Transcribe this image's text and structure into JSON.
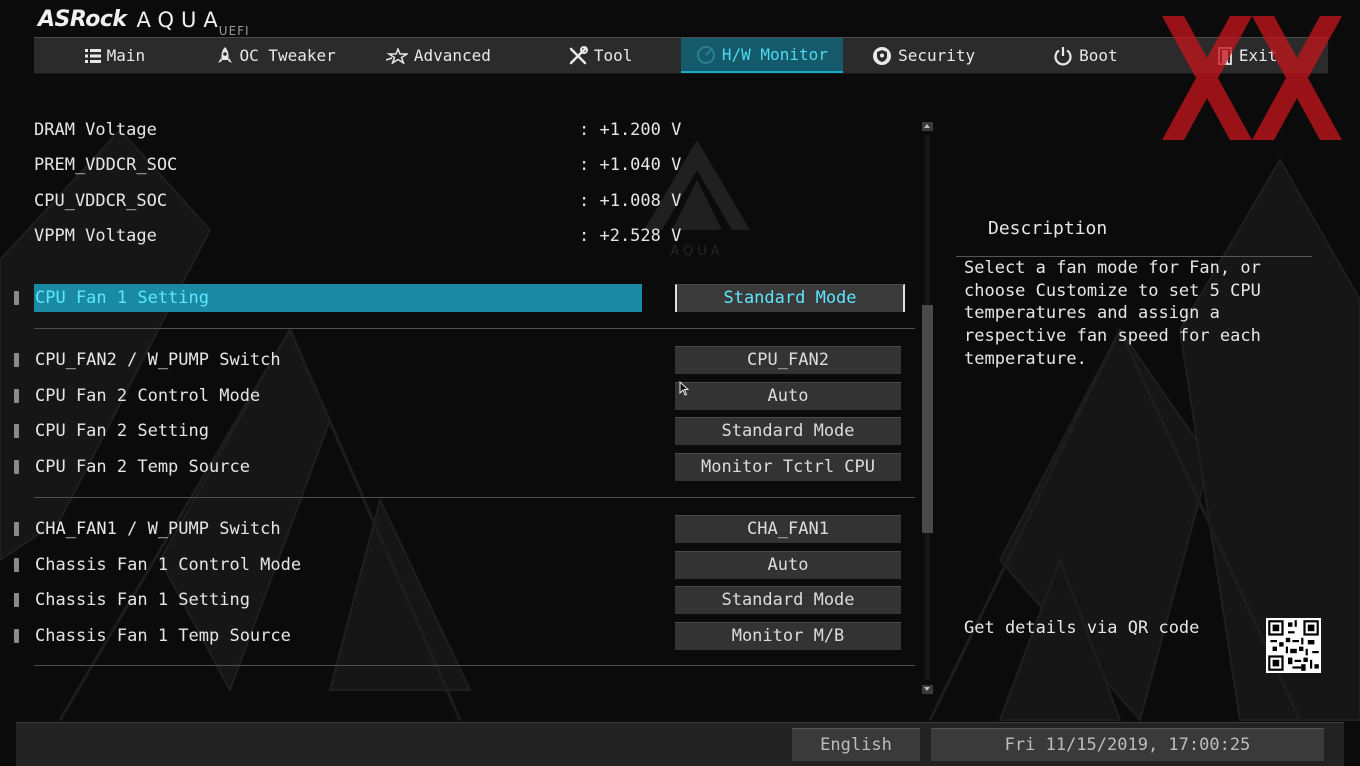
{
  "app": {
    "brand": "ASRock",
    "product": "AQUA",
    "sub": "UEFI",
    "watermark_text": "AQUA"
  },
  "nav": {
    "tabs": [
      {
        "label": "Main",
        "icon": "list-icon",
        "active": false
      },
      {
        "label": "OC Tweaker",
        "icon": "rocket-icon",
        "active": false
      },
      {
        "label": "Advanced",
        "icon": "star-icon",
        "active": false
      },
      {
        "label": "Tool",
        "icon": "tools-icon",
        "active": false
      },
      {
        "label": "H/W Monitor",
        "icon": "monitor-gauge-icon",
        "active": true
      },
      {
        "label": "Security",
        "icon": "shield-icon",
        "active": false
      },
      {
        "label": "Boot",
        "icon": "power-icon",
        "active": false
      },
      {
        "label": "Exit",
        "icon": "exit-door-icon",
        "active": false
      }
    ]
  },
  "readings": [
    {
      "label": "DRAM Voltage",
      "value": ": +1.200 V"
    },
    {
      "label": "PREM_VDDCR_SOC",
      "value": ": +1.040 V"
    },
    {
      "label": "CPU_VDDCR_SOC",
      "value": ": +1.008 V"
    },
    {
      "label": "VPPM Voltage",
      "value": ": +2.528 V"
    }
  ],
  "settings": [
    {
      "label": "CPU Fan 1 Setting",
      "value": "Standard Mode",
      "selected": true
    },
    {
      "label": "CPU_FAN2 / W_PUMP Switch",
      "value": "CPU_FAN2",
      "selected": false
    },
    {
      "label": "CPU Fan 2 Control Mode",
      "value": "Auto",
      "selected": false
    },
    {
      "label": "CPU Fan 2 Setting",
      "value": "Standard Mode",
      "selected": false
    },
    {
      "label": "CPU Fan 2 Temp Source",
      "value": "Monitor Tctrl CPU",
      "selected": false
    },
    {
      "label": "CHA_FAN1 / W_PUMP Switch",
      "value": "CHA_FAN1",
      "selected": false
    },
    {
      "label": "Chassis Fan 1 Control Mode",
      "value": "Auto",
      "selected": false
    },
    {
      "label": "Chassis Fan 1 Setting",
      "value": "Standard Mode",
      "selected": false
    },
    {
      "label": "Chassis Fan 1 Temp Source",
      "value": "Monitor M/B",
      "selected": false
    }
  ],
  "description": {
    "title": "Description",
    "text": "Select a fan mode for Fan, or choose Customize to set 5 CPU temperatures and assign a respective fan speed for each temperature."
  },
  "qr": {
    "label": "Get details via QR code"
  },
  "footer": {
    "language": "English",
    "datetime": "Fri 11/15/2019, 17:00:25"
  },
  "colors": {
    "accent": "#1a8aa3",
    "accent_text": "#5fe6ff",
    "active_tab_bg": "#145a6a",
    "watermark_red": "#c4161c"
  }
}
